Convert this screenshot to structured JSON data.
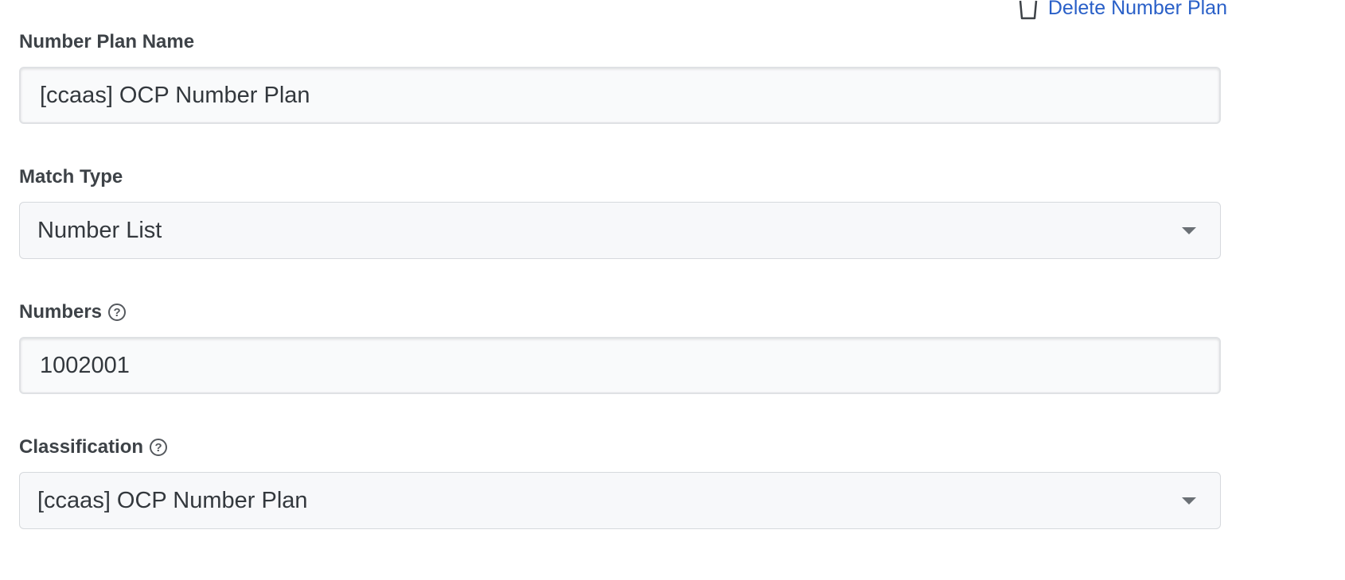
{
  "actions": {
    "delete_label": "Delete Number Plan",
    "delete_icon": "trash-icon"
  },
  "fields": {
    "name": {
      "label": "Number Plan Name",
      "value": "[ccaas] OCP Number Plan"
    },
    "match_type": {
      "label": "Match Type",
      "value": "Number List"
    },
    "numbers": {
      "label": "Numbers",
      "value": "1002001",
      "help_icon": "help-circle-icon",
      "help_glyph": "?"
    },
    "classification": {
      "label": "Classification",
      "value": "[ccaas] OCP Number Plan",
      "help_icon": "help-circle-icon",
      "help_glyph": "?"
    }
  },
  "colors": {
    "link": "#2a60c8",
    "label": "#3d4247",
    "input_bg": "#f9fafb",
    "border": "#dfe1e4"
  }
}
